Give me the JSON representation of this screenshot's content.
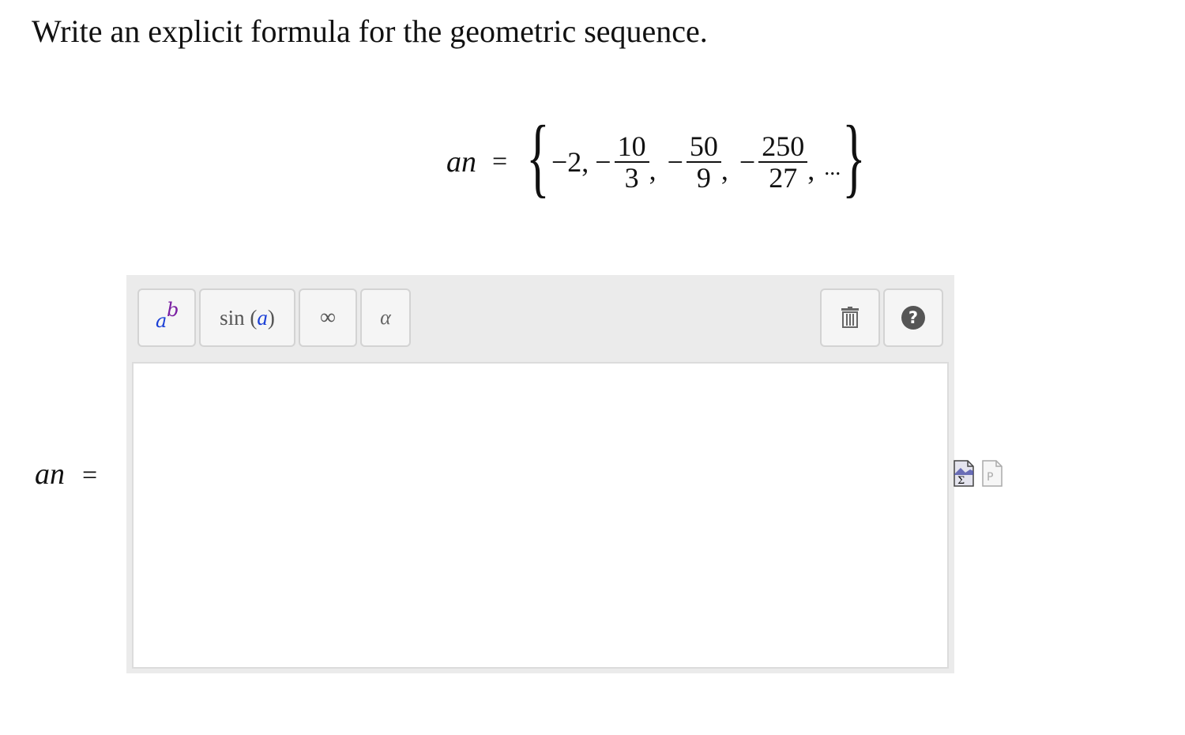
{
  "question": {
    "text": "Write an explicit formula for the geometric sequence."
  },
  "sequence": {
    "variable": "an",
    "equals": "=",
    "brace_open": "{",
    "brace_close": "}",
    "first_term": "−2,",
    "terms": [
      {
        "sign": "−",
        "numerator": "10",
        "denominator": "3",
        "separator": ","
      },
      {
        "sign": "−",
        "numerator": "50",
        "denominator": "9",
        "separator": ","
      },
      {
        "sign": "−",
        "numerator": "250",
        "denominator": "27",
        "separator": ","
      }
    ],
    "ellipsis": "..."
  },
  "answer": {
    "variable": "an",
    "equals": "="
  },
  "toolbar": {
    "power_base": "a",
    "power_exponent": "b",
    "sin_func": "sin",
    "sin_open": "(",
    "sin_arg": "a",
    "sin_close": ")",
    "infinity": "∞",
    "alpha": "α",
    "help": "?"
  },
  "icons": {
    "power": "superscript-icon",
    "trash": "trash-icon",
    "help": "help-icon",
    "equation_editor": "equation-editor-icon",
    "preview": "preview-icon"
  },
  "colors": {
    "accent_blue": "#1a3fd6",
    "accent_purple": "#7a1fa2",
    "toolbar_bg": "#ebebeb"
  }
}
